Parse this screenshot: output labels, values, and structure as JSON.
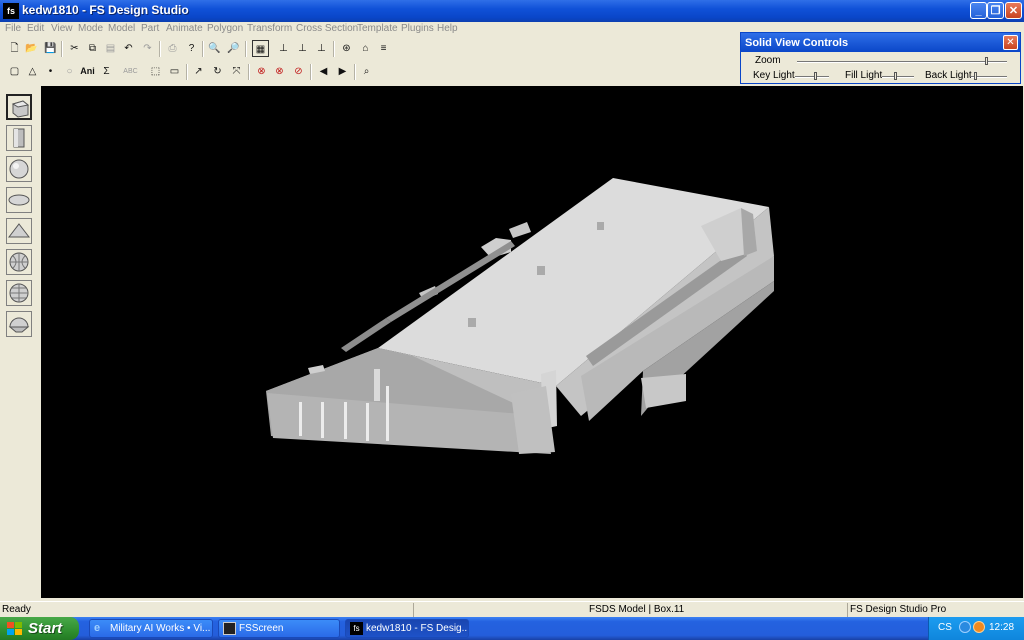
{
  "window": {
    "title": "kedw1810 - FS Design Studio",
    "icon_label": "fs"
  },
  "menu": [
    "File",
    "Edit",
    "View",
    "Mode",
    "Model",
    "Part",
    "Animate",
    "Polygon",
    "Transform",
    "Cross Section",
    "Template",
    "Plugins",
    "Help"
  ],
  "toolbar_row1": [
    "new-file",
    "open-folder",
    "save",
    "cut",
    "copy",
    "paste",
    "undo",
    "redo",
    "print",
    "help",
    "zoom-in",
    "zoom-out",
    "grid",
    "snap-x",
    "snap-y",
    "snap-z",
    "view-3d",
    "home",
    "layers"
  ],
  "toolbar_row2": {
    "labels": {
      "ani": "Ani",
      "sum": "Σ",
      "abc": "ABC"
    }
  },
  "solid_view_controls": {
    "title": "Solid View Controls",
    "zoom_label": "Zoom",
    "key_light_label": "Key Light",
    "fill_light_label": "Fill Light",
    "back_light_label": "Back Light",
    "zoom_level": 0.9,
    "key_light_level": 0.6,
    "fill_light_level": 0.4,
    "back_light_level": 0.1
  },
  "left_tools": [
    "box-tool",
    "cylinder-tool",
    "sphere-tool",
    "ellipsoid-tool",
    "pyramid-tool",
    "globe-tool",
    "dome-tool",
    "half-sphere-tool"
  ],
  "status": {
    "ready": "Ready",
    "model": "FSDS Model | Box.11",
    "product": "FS Design Studio Pro"
  },
  "taskbar": {
    "start_label": "Start",
    "tasks": [
      {
        "label": "Military AI Works • Vi...",
        "active": false
      },
      {
        "label": "FSScreen",
        "active": false
      },
      {
        "label": "kedw1810 - FS Desig...",
        "active": true
      }
    ],
    "tray_lang": "CS",
    "clock": "12:28"
  },
  "colors": {
    "viewport": "#000000",
    "model": "#d4d4d4",
    "titlebar": "#0a46c8"
  }
}
